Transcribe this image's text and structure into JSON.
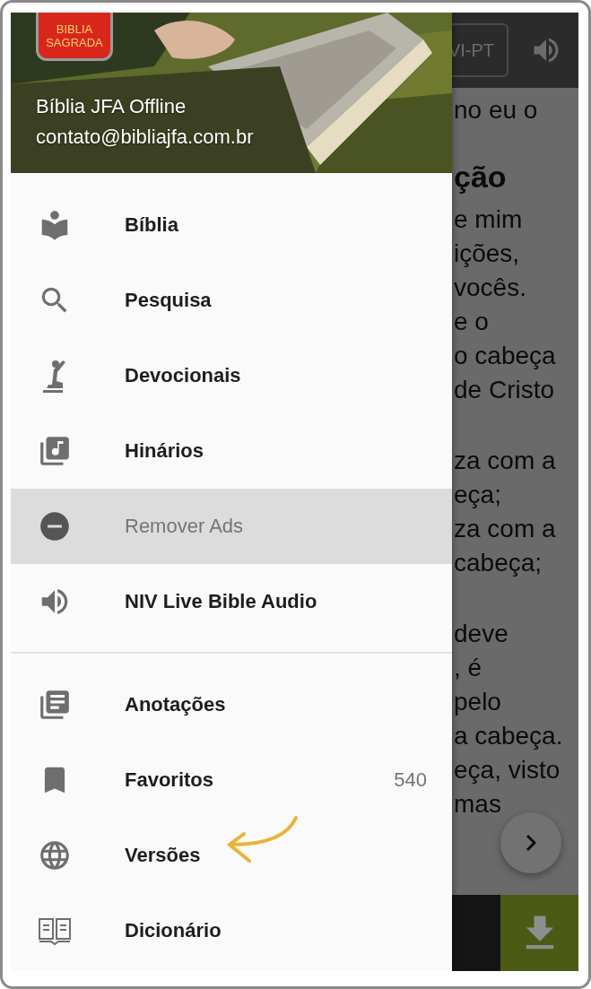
{
  "app_bar": {
    "version_button": "VI-PT"
  },
  "reader": {
    "intro_lines": [
      "no eu o"
    ],
    "heading": "ção",
    "paragraphs": [
      [
        "e mim",
        "ições,",
        "vocês.",
        "e o",
        "o cabeça",
        "de Cristo"
      ],
      [
        "za com a",
        "eça;",
        "za com a",
        "cabeça;"
      ],
      [
        "deve",
        ", é",
        "pelo",
        "a cabeça.",
        "eça, visto",
        "mas"
      ]
    ]
  },
  "drawer": {
    "logo": {
      "line_1": "BIBLIA",
      "line_2": "SAGRADA"
    },
    "app_name": "Bíblia JFA Offline",
    "email": "contato@bibliajfa.com.br",
    "sections": [
      {
        "items": [
          {
            "label": "Bíblia",
            "selected": false
          },
          {
            "label": "Pesquisa",
            "selected": false
          },
          {
            "label": "Devocionais",
            "selected": false
          },
          {
            "label": "Hinários",
            "selected": false
          },
          {
            "label": "Remover Ads",
            "selected": true
          },
          {
            "label": "NIV Live Bible Audio",
            "selected": false
          }
        ]
      },
      {
        "items": [
          {
            "label": "Anotações",
            "selected": false
          },
          {
            "label": "Favoritos",
            "selected": false,
            "count": "540"
          },
          {
            "label": "Versões",
            "selected": false,
            "pointer": true
          },
          {
            "label": "Dicionário",
            "selected": false
          }
        ]
      }
    ]
  }
}
